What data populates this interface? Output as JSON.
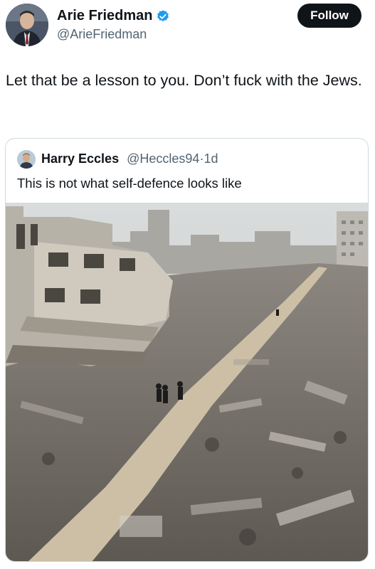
{
  "post": {
    "author": {
      "display_name": "Arie Friedman",
      "handle": "@ArieFriedman",
      "verified": true,
      "avatar_icon": "profile-photo"
    },
    "follow_label": "Follow",
    "text": "Let that be a lesson to you. Don’t fuck with the Jews."
  },
  "quoted_post": {
    "author": {
      "display_name": "Harry Eccles",
      "handle": "@Heccles94",
      "separator": "·",
      "age": "1d",
      "avatar_icon": "profile-photo"
    },
    "text": "This is not what self-defence looks like",
    "image": {
      "icon": "photo-destroyed-buildings-street"
    }
  },
  "colors": {
    "follow_bg": "#0f1419",
    "verified_blue": "#1d9bf0",
    "secondary_text": "#536471",
    "border": "#cfd9de"
  }
}
